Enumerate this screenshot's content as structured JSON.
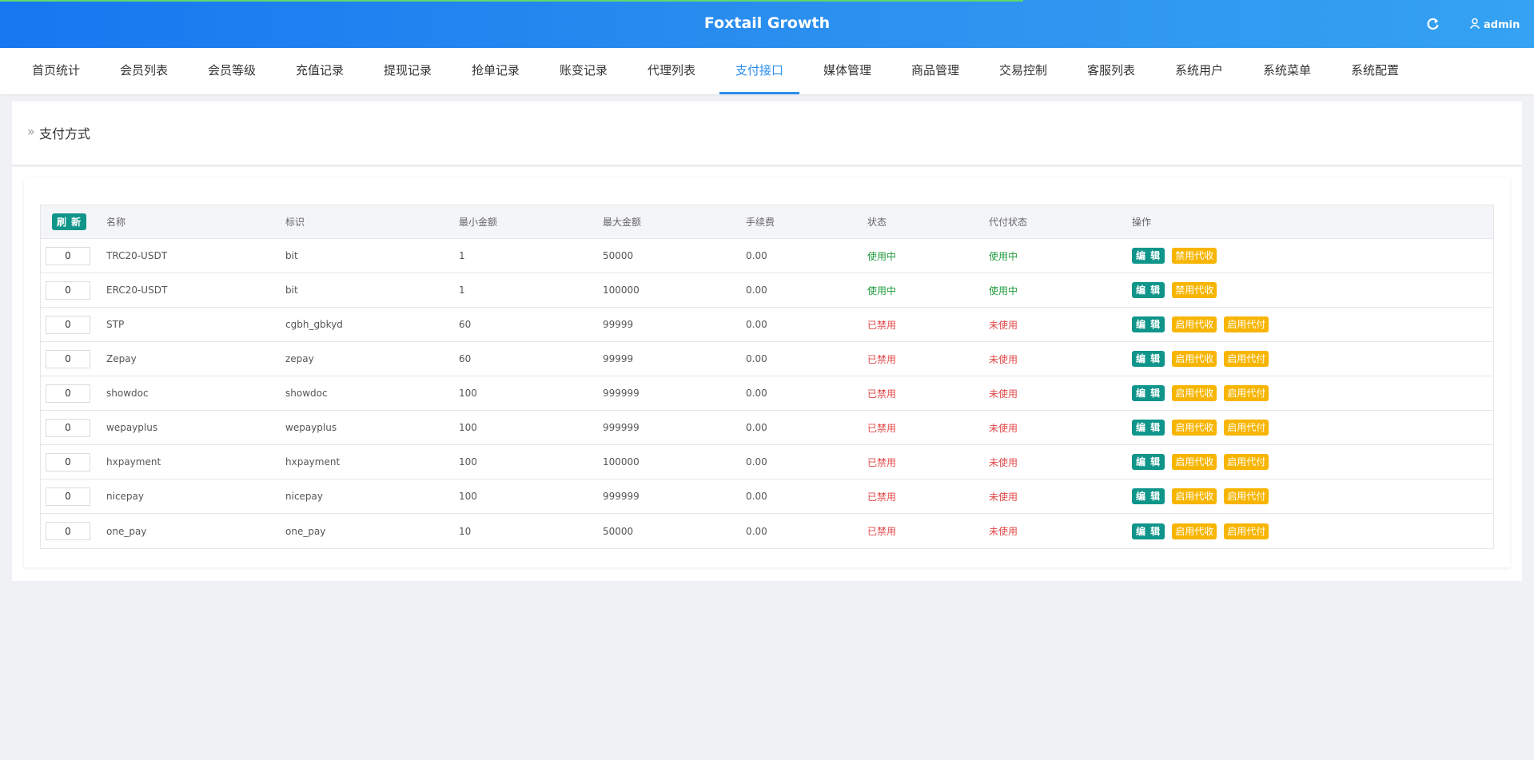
{
  "app": {
    "title": "Foxtail Growth",
    "user": "admin"
  },
  "nav": [
    {
      "label": "首页统计",
      "active": false
    },
    {
      "label": "会员列表",
      "active": false
    },
    {
      "label": "会员等级",
      "active": false
    },
    {
      "label": "充值记录",
      "active": false
    },
    {
      "label": "提现记录",
      "active": false
    },
    {
      "label": "抢单记录",
      "active": false
    },
    {
      "label": "账变记录",
      "active": false
    },
    {
      "label": "代理列表",
      "active": false
    },
    {
      "label": "支付接口",
      "active": true
    },
    {
      "label": "媒体管理",
      "active": false
    },
    {
      "label": "商品管理",
      "active": false
    },
    {
      "label": "交易控制",
      "active": false
    },
    {
      "label": "客服列表",
      "active": false
    },
    {
      "label": "系统用户",
      "active": false
    },
    {
      "label": "系统菜单",
      "active": false
    },
    {
      "label": "系统配置",
      "active": false
    }
  ],
  "page": {
    "title": "支付方式",
    "breadcrumb_icon": "»"
  },
  "table": {
    "refresh_label": "刷 新",
    "columns": [
      "名称",
      "标识",
      "最小金额",
      "最大金额",
      "手续费",
      "状态",
      "代付状态",
      "操作"
    ],
    "rows": [
      {
        "sort": "0",
        "name": "TRC20-USDT",
        "code": "bit",
        "min": "1",
        "max": "50000",
        "fee": "0.00",
        "status": "使用中",
        "payout_status": "使用中",
        "enabled": true,
        "actions": [
          "编 辑",
          "禁用代收"
        ]
      },
      {
        "sort": "0",
        "name": "ERC20-USDT",
        "code": "bit",
        "min": "1",
        "max": "100000",
        "fee": "0.00",
        "status": "使用中",
        "payout_status": "使用中",
        "enabled": true,
        "actions": [
          "编 辑",
          "禁用代收"
        ]
      },
      {
        "sort": "0",
        "name": "STP",
        "code": "cgbh_gbkyd",
        "min": "60",
        "max": "99999",
        "fee": "0.00",
        "status": "已禁用",
        "payout_status": "未使用",
        "enabled": false,
        "actions": [
          "编 辑",
          "启用代收",
          "启用代付"
        ]
      },
      {
        "sort": "0",
        "name": "Zepay",
        "code": "zepay",
        "min": "60",
        "max": "99999",
        "fee": "0.00",
        "status": "已禁用",
        "payout_status": "未使用",
        "enabled": false,
        "actions": [
          "编 辑",
          "启用代收",
          "启用代付"
        ]
      },
      {
        "sort": "0",
        "name": "showdoc",
        "code": "showdoc",
        "min": "100",
        "max": "999999",
        "fee": "0.00",
        "status": "已禁用",
        "payout_status": "未使用",
        "enabled": false,
        "actions": [
          "编 辑",
          "启用代收",
          "启用代付"
        ]
      },
      {
        "sort": "0",
        "name": "wepayplus",
        "code": "wepayplus",
        "min": "100",
        "max": "999999",
        "fee": "0.00",
        "status": "已禁用",
        "payout_status": "未使用",
        "enabled": false,
        "actions": [
          "编 辑",
          "启用代收",
          "启用代付"
        ]
      },
      {
        "sort": "0",
        "name": "hxpayment",
        "code": "hxpayment",
        "min": "100",
        "max": "100000",
        "fee": "0.00",
        "status": "已禁用",
        "payout_status": "未使用",
        "enabled": false,
        "actions": [
          "编 辑",
          "启用代收",
          "启用代付"
        ]
      },
      {
        "sort": "0",
        "name": "nicepay",
        "code": "nicepay",
        "min": "100",
        "max": "999999",
        "fee": "0.00",
        "status": "已禁用",
        "payout_status": "未使用",
        "enabled": false,
        "actions": [
          "编 辑",
          "启用代收",
          "启用代付"
        ]
      },
      {
        "sort": "0",
        "name": "one_pay",
        "code": "one_pay",
        "min": "10",
        "max": "50000",
        "fee": "0.00",
        "status": "已禁用",
        "payout_status": "未使用",
        "enabled": false,
        "actions": [
          "编 辑",
          "启用代收",
          "启用代付"
        ]
      }
    ]
  },
  "colors": {
    "header": "#2a8ef0",
    "nav_active": "#2a8ef0",
    "teal": "#10958a",
    "warning": "#f7b500",
    "status_on": "#1f9a3b",
    "status_off": "#e04848"
  },
  "icons": {
    "refresh": "refresh-icon",
    "user": "user-icon"
  }
}
